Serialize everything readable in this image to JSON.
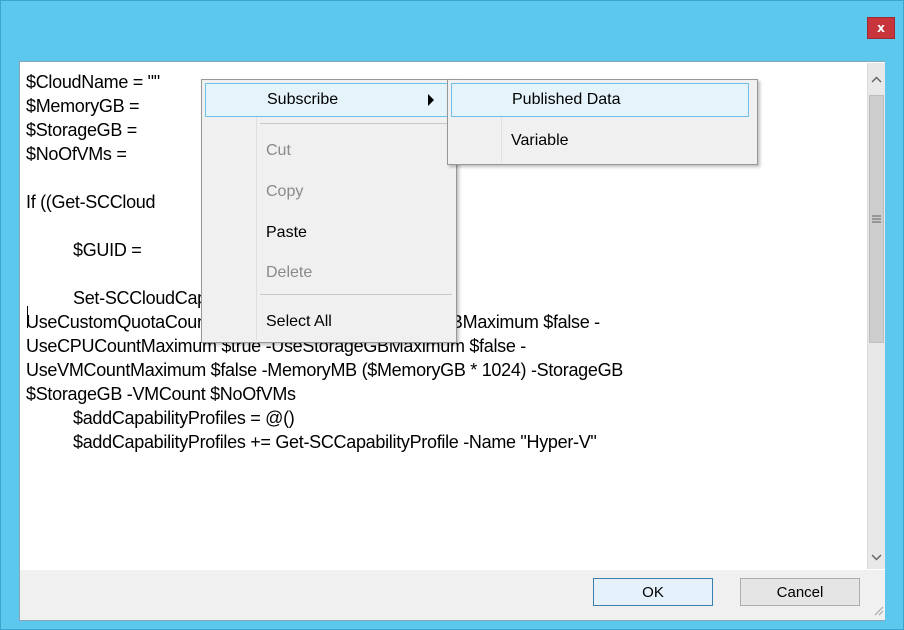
{
  "window": {
    "close_label": "x"
  },
  "editor": {
    "lines": [
      "$CloudName = \"\"",
      "$MemoryGB = ",
      "$StorageGB = ",
      "$NoOfVMs = ",
      "",
      "If ((Get-SCCloud                            eq $null) {",
      "",
      "          $GUID =                                  d().ToString()",
      "",
      "          Set-SCCloudCapacity -JobGroup \"$GUID\" -",
      "UseCustomQuotaCountMaximum $true -UseMemoryMBMaximum $false -",
      "UseCPUCountMaximum $true -UseStorageGBMaximum $false -",
      "UseVMCountMaximum $false -MemoryMB ($MemoryGB * 1024) -StorageGB",
      "$StorageGB -VMCount $NoOfVMs",
      "          $addCapabilityProfiles = @()",
      "          $addCapabilityProfiles += Get-SCCapabilityProfile -Name \"Hyper-V\""
    ]
  },
  "context_menu": {
    "items": [
      {
        "label": "Subscribe",
        "enabled": true,
        "highlighted": true,
        "has_submenu": true
      },
      {
        "label": "Cut",
        "enabled": false
      },
      {
        "label": "Copy",
        "enabled": false
      },
      {
        "label": "Paste",
        "enabled": true
      },
      {
        "label": "Delete",
        "enabled": false
      },
      {
        "label": "Select All",
        "enabled": true
      }
    ]
  },
  "submenu": {
    "items": [
      {
        "label": "Published Data",
        "highlighted": true
      },
      {
        "label": "Variable",
        "highlighted": false
      }
    ]
  },
  "buttons": {
    "ok": "OK",
    "cancel": "Cancel"
  },
  "colors": {
    "title_bar": "#5cc8ee",
    "close_button": "#c7343b",
    "menu_highlight": "#e5f3fb",
    "menu_highlight_border": "#70c0e7"
  }
}
